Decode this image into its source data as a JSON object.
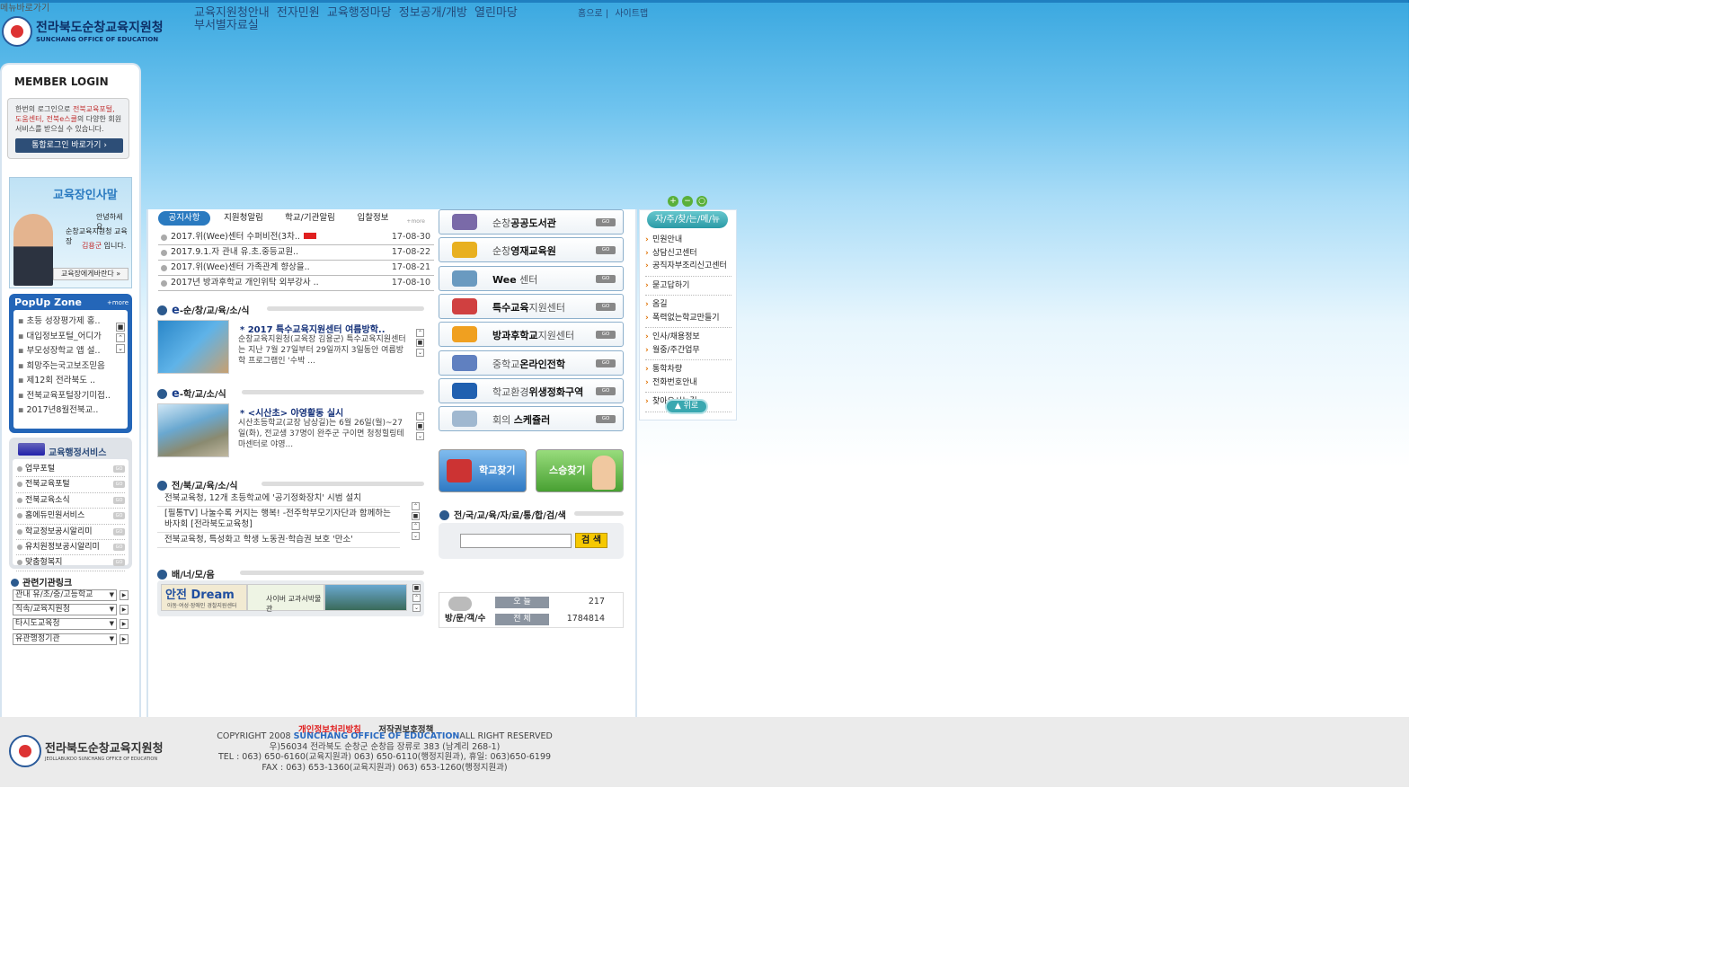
{
  "skip_link": "메뉴바로가기",
  "site": {
    "name_ko": "전라북도순창교육지원청",
    "name_en": "SUNCHANG OFFICE OF EDUCATION"
  },
  "gnb": [
    "교육지원청안내",
    "전자민원",
    "교육행정마당",
    "정보공개/개방",
    "열린마당",
    "부서별자료실"
  ],
  "util": [
    "홈으로 |",
    "사이트맵"
  ],
  "login": {
    "title": "MEMBER LOGIN",
    "desc_a": "한번의 로그인으로 ",
    "desc_b": "전북교육포털,",
    "desc_c": "도움센터, 전북e스쿨",
    "desc_d": "의 다양한 회원서비스를 받으실 수 있습니다.",
    "button": "통합로그인 바로가기 ›"
  },
  "greeting": {
    "title": "교육장인사말",
    "l1": "안녕하세요,",
    "l2": "순창교육지원청 교육장",
    "name": "김용군",
    "l3": " 입니다.",
    "button": "교육장에게바란다 »"
  },
  "popup": {
    "title": "PopUp Zone",
    "more": "+more",
    "items": [
      "초등 성장평가제 홍..",
      "대입정보포털_어디가",
      "부모성장학교 앱 설..",
      "희망주는국고보조믿음",
      "제12회 전라북도 ..",
      "전북교육포털장기미접..",
      "2017년8월전북교.."
    ]
  },
  "admin": {
    "title": "교육행정서비스",
    "items": [
      "업무포털",
      "전북교육포털",
      "전북교육소식",
      "홈에듀민원서비스",
      "학교정보공시알리미",
      "유치원정보공시알리미",
      "맞춤형복지"
    ],
    "go": "GO"
  },
  "related": {
    "title": "관련기관링크",
    "selects": [
      "관내 유/초/중/고등학교",
      "직속/교육지원청",
      "타시도교육청",
      "유관행정기관"
    ]
  },
  "tabs": {
    "labels": [
      "공지사항",
      "지원청알림",
      "학교/기관알림",
      "입찰정보"
    ],
    "more": "+more"
  },
  "notices": [
    {
      "title": "2017.위(Wee)센터 수퍼비전(3차..",
      "date": "17-08-30",
      "new": true
    },
    {
      "title": "2017.9.1.자 관내 유.초.중등교원..",
      "date": "17-08-22",
      "new": false
    },
    {
      "title": "2017.위(Wee)센터 가족관계 향상을..",
      "date": "17-08-21",
      "new": false
    },
    {
      "title": "2017년 방과후학교 개인위탁 외부강사 ..",
      "date": "17-08-10",
      "new": false
    }
  ],
  "news1": {
    "prefix": "e",
    "title": "-순/창/교/육/소/식",
    "headline": "* 2017 특수교육지원센터 여름방학..",
    "body": "순창교육지원청(교육장 김용군) 특수교육지원센터는 지난 7월 27일부터 29일까지 3일동안 여름방학 프로그램인 '수박 ..."
  },
  "news2": {
    "prefix": "e",
    "title": "-학/교/소/식",
    "headline": "* <시산초> 야영활동 실시",
    "body": "시산초등학교(교장 남상길)는 6월 26일(월)~27일(화), 전교생 37명이 완주군 구이면 청정힐링테마센터로 야영..."
  },
  "jeonbuk": {
    "title": "전/북/교/육/소/식",
    "items": [
      "전북교육청, 12개 초등학교에 '공기정화장치' 시범 설치",
      "[필통TV] 나눌수록 커지는 행복! -전주학부모기자단과 함께하는 바자회 [전라북도교육청]",
      "전북교육청, 특성화고 학생 노동권·학습권 보호 '만소'"
    ]
  },
  "banners": {
    "title": "배/너/모/음",
    "b1": "안전 Dream",
    "b1_sub": "아동·여성·장애인 경찰지원센터",
    "b2": "사이버 교과서박물관"
  },
  "quick": [
    {
      "pre": "순창",
      "bold": "공공도서관",
      "post": "",
      "color": "#7a6aa8"
    },
    {
      "pre": "순창",
      "bold": "영재교육원",
      "post": "",
      "color": "#e8b020"
    },
    {
      "pre": "",
      "bold": "Wee",
      "post": " 센터",
      "color": "#6a9ac0"
    },
    {
      "pre": "",
      "bold": "특수교육",
      "post": "지원센터",
      "color": "#d04040"
    },
    {
      "pre": "",
      "bold": "방과후학교",
      "post": "지원센터",
      "color": "#f0a020"
    },
    {
      "pre": "중학교",
      "bold": "온라인전학",
      "post": "",
      "color": "#6080c0"
    },
    {
      "pre": "학교환경",
      "bold": "위생정화구역",
      "post": "",
      "color": "#2060b0"
    },
    {
      "pre": "회의 ",
      "bold": "스케쥴러",
      "post": "",
      "color": "#a0b8d0"
    }
  ],
  "quick_go": "GO",
  "big_buttons": [
    "학교찾기",
    "스승찾기"
  ],
  "search": {
    "title": "전/국/교/육/자/료/통/합/검/색",
    "button": "검 색",
    "value": ""
  },
  "visitors": {
    "label": "방/문/객/수",
    "today_label": "오 늘",
    "today": "217",
    "total_label": "전 체",
    "total": "1784814"
  },
  "zoom": [
    "+",
    "−",
    "○"
  ],
  "fav": {
    "title": "자/주/찾/는/메/뉴",
    "items": [
      "민원안내",
      "상담신고센터",
      "공직자부조리신고센터",
      "묻고답하기",
      "옴길",
      "폭력없는학교만들기",
      "인사/채용정보",
      "월중/주간업무",
      "통학차량",
      "전화번호안내",
      "찾아오시는길"
    ],
    "up": "위로"
  },
  "footer": {
    "privacy": "개인정보처리방침",
    "copyright_policy": "저작권보호정책",
    "copy_a": "COPYRIGHT 2008 ",
    "copy_b": "SUNCHANG OFFICE OF EDUCATION",
    "copy_c": "ALL RIGHT RESERVED",
    "addr": "우)56034   전라북도 순창군 순창읍 장류로 383 (남계리 268-1)",
    "tel": "TEL : 063) 650-6160(교육지원과) 063) 650-6110(행정지원과),   휴일: 063)650-6199",
    "fax": "FAX : 063) 653-1360(교육지원과) 063) 653-1260(행정지원과)",
    "logo_ko": "전라북도순창교육지원청",
    "logo_en": "JEOLLABUKDO SUNCHANG OFFICE OF EDUCATION"
  }
}
